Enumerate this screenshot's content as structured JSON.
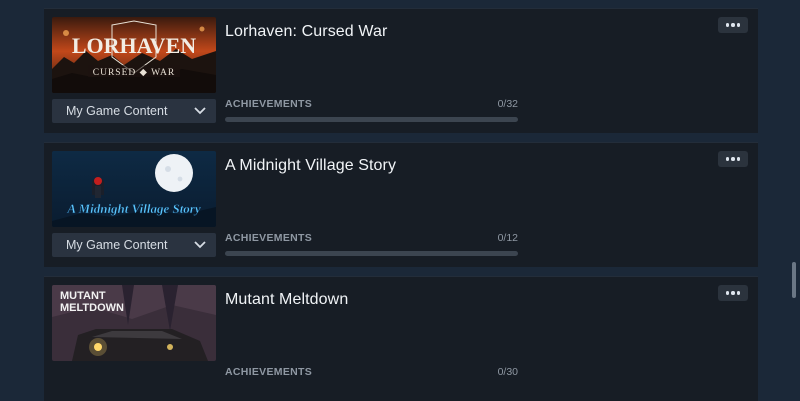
{
  "games": [
    {
      "title": "Lorhaven: Cursed War",
      "dropdown_label": "My Game Content",
      "achievements_label": "ACHIEVEMENTS",
      "achievements_count": "0/32",
      "progress_fraction": 0,
      "thumb_title": "LORHAVEN",
      "thumb_subtitle": "CURSED ◆ WAR"
    },
    {
      "title": "A Midnight Village Story",
      "dropdown_label": "My Game Content",
      "achievements_label": "ACHIEVEMENTS",
      "achievements_count": "0/12",
      "progress_fraction": 0,
      "thumb_title": "A Midnight Village Story"
    },
    {
      "title": "Mutant Meltdown",
      "achievements_label": "ACHIEVEMENTS",
      "achievements_count": "0/30",
      "progress_fraction": 0,
      "thumb_title_line1": "MUTANT",
      "thumb_title_line2": "MELTDOWN"
    }
  ],
  "icons": {
    "more": "more-options-icon",
    "dropdown": "chevron-down-icon"
  },
  "colors": {
    "background": "#1b2838",
    "card": "#171d25",
    "progress_track": "#3c4550"
  }
}
